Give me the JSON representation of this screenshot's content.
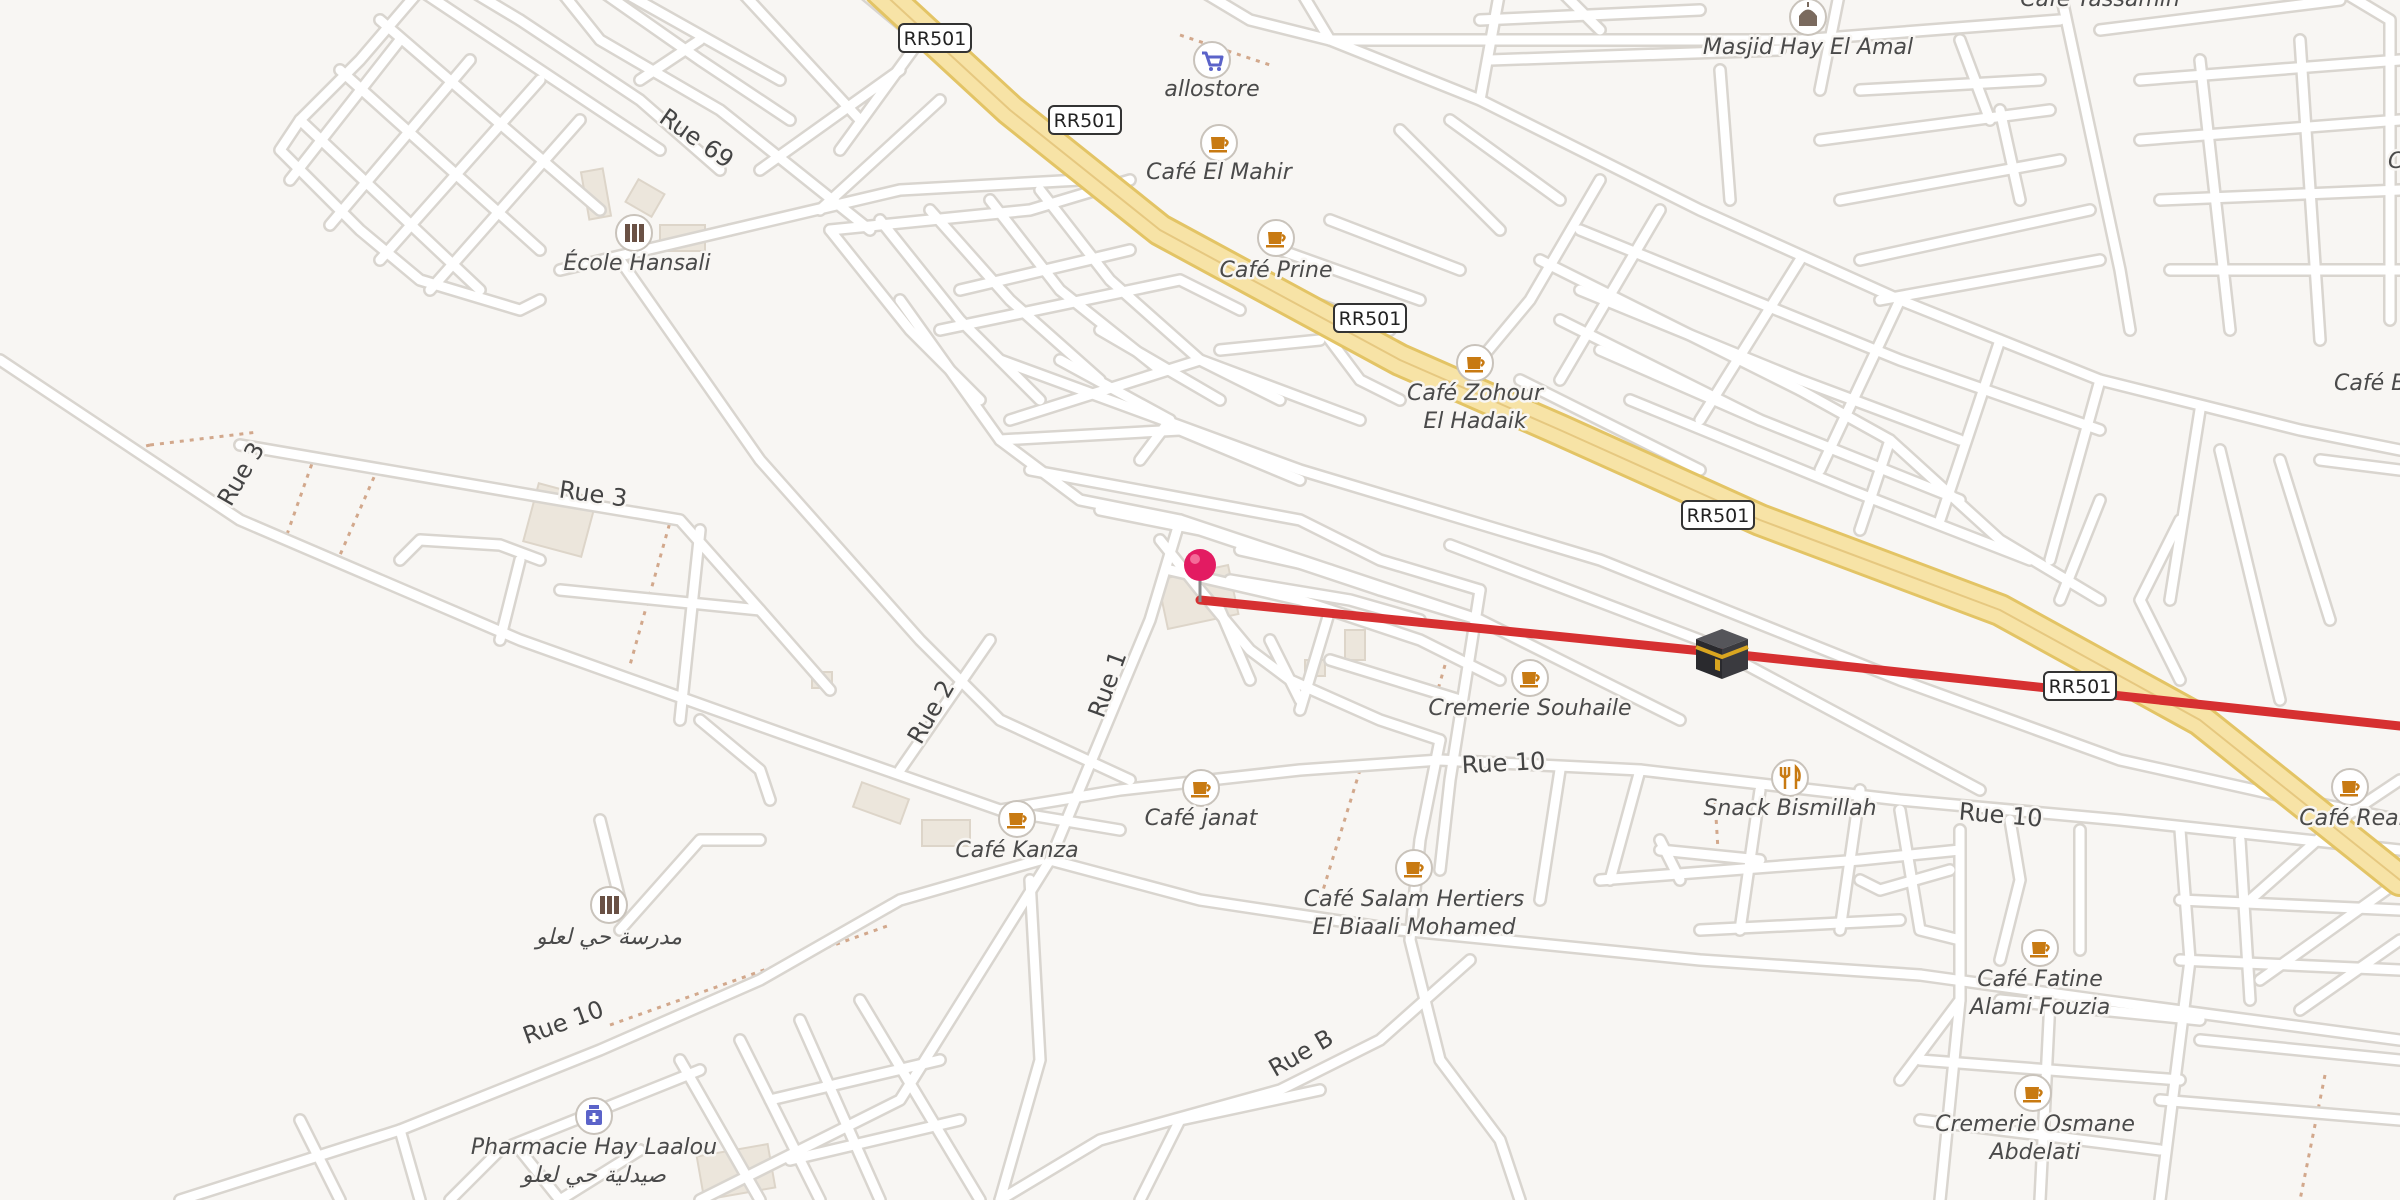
{
  "map": {
    "colors": {
      "background": "#f8f6f3",
      "road": "#ffffff",
      "road_casing": "#dcd8d2",
      "highway": "#f7e3a6",
      "highway_casing": "#e3c465",
      "building": "#ece6dc",
      "path": "#d2a88c",
      "route": "#d63031",
      "pin": "#e31b62",
      "poi_cafe": "#c87a12",
      "poi_shop": "#5b63c9",
      "poi_school": "#6a5145",
      "poi_mosque": "#7a6a5e"
    },
    "road_labels": {
      "rue69": "Rue 69",
      "rue3_a": "Rue 3",
      "rue3_b": "Rue 3",
      "rue2": "Rue 2",
      "rue1": "Rue 1",
      "rue10_a": "Rue 10",
      "rue10_b": "Rue 10",
      "rue10_c": "Rue 10",
      "rueb": "Rue B"
    },
    "highway_shields": [
      "RR501",
      "RR501",
      "RR501",
      "RR501",
      "RR501"
    ],
    "pois": {
      "masjid": {
        "icon": "mosque-icon",
        "line1": "Masjid Hay El Amal"
      },
      "allostore": {
        "icon": "shopping-cart-icon",
        "line1": "allostore"
      },
      "cafe_mahir": {
        "icon": "coffee-cup-icon",
        "line1": "Café El Mahir"
      },
      "cafe_prine": {
        "icon": "coffee-cup-icon",
        "line1": "Café Prine"
      },
      "cafe_zohour": {
        "icon": "coffee-cup-icon",
        "line1": "Café Zohour",
        "line2": "El Hadaik"
      },
      "ecole": {
        "icon": "school-icon",
        "line1": "École Hansali"
      },
      "cremerie_souhaile": {
        "icon": "coffee-cup-icon",
        "line1": "Cremerie Souhaile"
      },
      "snack": {
        "icon": "fork-knife-icon",
        "line1": "Snack Bismillah"
      },
      "cafe_janat": {
        "icon": "coffee-cup-icon",
        "line1": "Café janat"
      },
      "cafe_kanza": {
        "icon": "coffee-cup-icon",
        "line1": "Café Kanza"
      },
      "cafe_salam": {
        "icon": "coffee-cup-icon",
        "line1": "Café Salam Hertiers",
        "line2": "El Biaali Mohamed"
      },
      "madrasa": {
        "icon": "school-icon",
        "line1": "مدرسة حي لعلو"
      },
      "cafe_real": {
        "icon": "coffee-cup-icon",
        "line1": "Café Real"
      },
      "cafe_fatine": {
        "icon": "coffee-cup-icon",
        "line1": "Café Fatine",
        "line2": "Alami Fouzia"
      },
      "cremerie_osmane": {
        "icon": "coffee-cup-icon",
        "line1": "Cremerie Osmane",
        "line2": "Abdelati"
      },
      "pharmacie": {
        "icon": "pharmacy-icon",
        "line1": "Pharmacie Hay Laalou",
        "line2": "صيدلية حي لعلو"
      },
      "cafe_tassamin": {
        "line1": "Café Tassamin"
      },
      "cafe_b": {
        "line1": "Café Be"
      },
      "edge_c": {
        "line1": "C"
      }
    },
    "markers": {
      "location_pin": "location-pin-icon",
      "qibla_marker": "kaaba-icon"
    }
  }
}
